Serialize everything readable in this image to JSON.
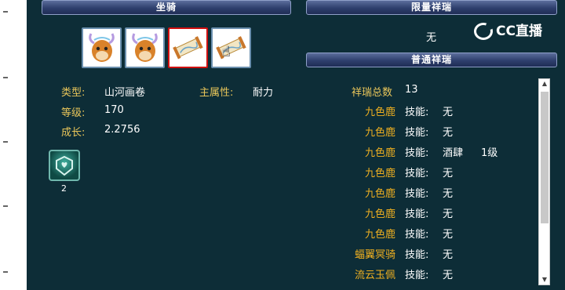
{
  "headers": {
    "mount": "坐骑",
    "limited_auspicious": "限量祥瑞",
    "normal_auspicious": "普通祥瑞"
  },
  "limited_value": "无",
  "brand": "CC直播",
  "mount_info": {
    "type_label": "类型:",
    "type_value": "山河画卷",
    "main_attr_label": "主属性:",
    "main_attr_value": "耐力",
    "level_label": "等级:",
    "level_value": "170",
    "growth_label": "成长:",
    "growth_value": "2.2756"
  },
  "skill_icon_count": "2",
  "auspicious": {
    "total_label": "祥瑞总数",
    "total_value": "13",
    "skill_label": "技能:",
    "rows": [
      {
        "name": "九色鹿",
        "skill": "无",
        "level": ""
      },
      {
        "name": "九色鹿",
        "skill": "无",
        "level": ""
      },
      {
        "name": "九色鹿",
        "skill": "酒肆",
        "level": "1级"
      },
      {
        "name": "九色鹿",
        "skill": "无",
        "level": ""
      },
      {
        "name": "九色鹿",
        "skill": "无",
        "level": ""
      },
      {
        "name": "九色鹿",
        "skill": "无",
        "level": ""
      },
      {
        "name": "九色鹿",
        "skill": "无",
        "level": ""
      },
      {
        "name": "蝠翼冥骑",
        "skill": "无",
        "level": ""
      },
      {
        "name": "流云玉佩",
        "skill": "无",
        "level": ""
      }
    ]
  },
  "icons": {
    "slot1": "deer-mount-icon",
    "slot2": "deer-mount-icon",
    "slot3": "scroll-mount-icon",
    "slot4": "scroll-mount-icon",
    "skill": "skill-emblem-icon"
  }
}
